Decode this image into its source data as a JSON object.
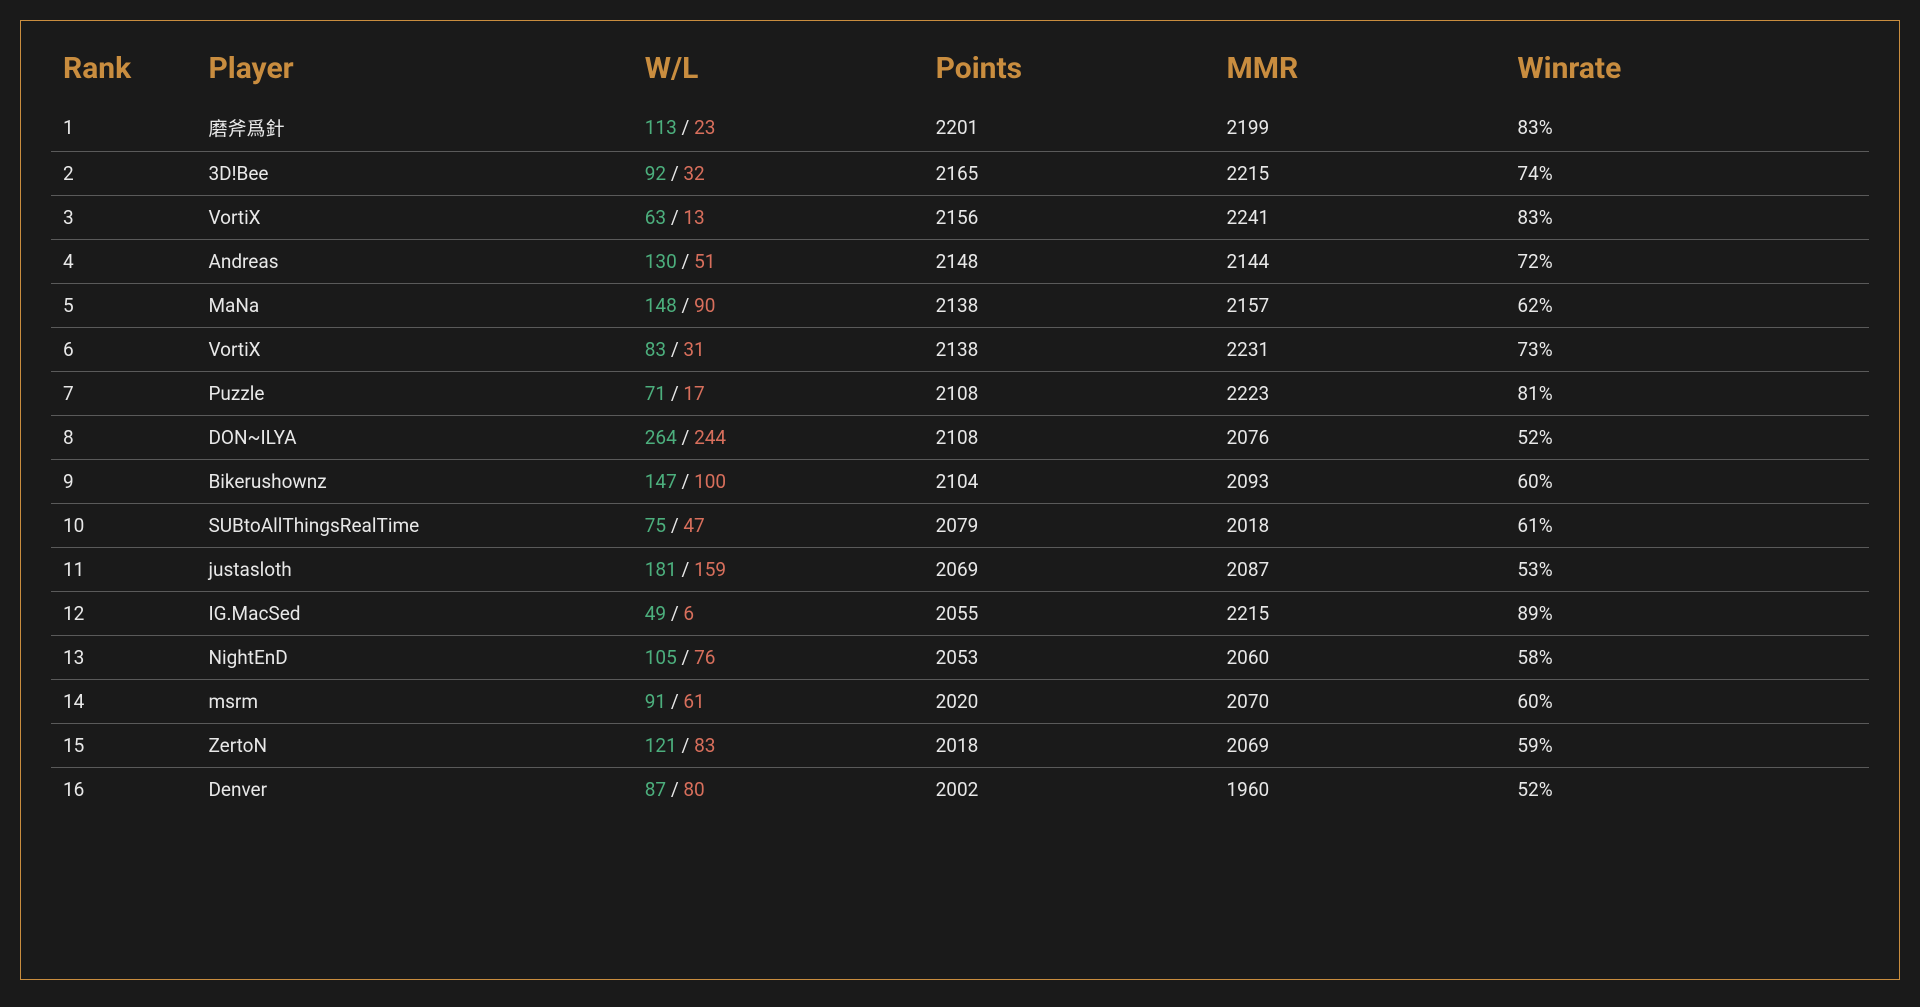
{
  "headers": {
    "rank": "Rank",
    "player": "Player",
    "wl": "W/L",
    "points": "Points",
    "mmr": "MMR",
    "winrate": "Winrate"
  },
  "rows": [
    {
      "rank": "1",
      "player": "磨斧爲針",
      "wins": "113",
      "losses": "23",
      "points": "2201",
      "mmr": "2199",
      "winrate": "83%"
    },
    {
      "rank": "2",
      "player": "3D!Bee",
      "wins": "92",
      "losses": "32",
      "points": "2165",
      "mmr": "2215",
      "winrate": "74%"
    },
    {
      "rank": "3",
      "player": "VortiX",
      "wins": "63",
      "losses": "13",
      "points": "2156",
      "mmr": "2241",
      "winrate": "83%"
    },
    {
      "rank": "4",
      "player": "Andreas",
      "wins": "130",
      "losses": "51",
      "points": "2148",
      "mmr": "2144",
      "winrate": "72%"
    },
    {
      "rank": "5",
      "player": "MaNa",
      "wins": "148",
      "losses": "90",
      "points": "2138",
      "mmr": "2157",
      "winrate": "62%"
    },
    {
      "rank": "6",
      "player": "VortiX",
      "wins": "83",
      "losses": "31",
      "points": "2138",
      "mmr": "2231",
      "winrate": "73%"
    },
    {
      "rank": "7",
      "player": "Puzzle",
      "wins": "71",
      "losses": "17",
      "points": "2108",
      "mmr": "2223",
      "winrate": "81%"
    },
    {
      "rank": "8",
      "player": "DON~ILYA",
      "wins": "264",
      "losses": "244",
      "points": "2108",
      "mmr": "2076",
      "winrate": "52%"
    },
    {
      "rank": "9",
      "player": "Bikerushownz",
      "wins": "147",
      "losses": "100",
      "points": "2104",
      "mmr": "2093",
      "winrate": "60%"
    },
    {
      "rank": "10",
      "player": "SUBtoAllThingsRealTime",
      "wins": "75",
      "losses": "47",
      "points": "2079",
      "mmr": "2018",
      "winrate": "61%"
    },
    {
      "rank": "11",
      "player": "justasloth",
      "wins": "181",
      "losses": "159",
      "points": "2069",
      "mmr": "2087",
      "winrate": "53%"
    },
    {
      "rank": "12",
      "player": "IG.MacSed",
      "wins": "49",
      "losses": "6",
      "points": "2055",
      "mmr": "2215",
      "winrate": "89%"
    },
    {
      "rank": "13",
      "player": "NightEnD",
      "wins": "105",
      "losses": "76",
      "points": "2053",
      "mmr": "2060",
      "winrate": "58%"
    },
    {
      "rank": "14",
      "player": "msrm",
      "wins": "91",
      "losses": "61",
      "points": "2020",
      "mmr": "2070",
      "winrate": "60%"
    },
    {
      "rank": "15",
      "player": "ZertoN",
      "wins": "121",
      "losses": "83",
      "points": "2018",
      "mmr": "2069",
      "winrate": "59%"
    },
    {
      "rank": "16",
      "player": "Denver",
      "wins": "87",
      "losses": "80",
      "points": "2002",
      "mmr": "1960",
      "winrate": "52%"
    }
  ]
}
